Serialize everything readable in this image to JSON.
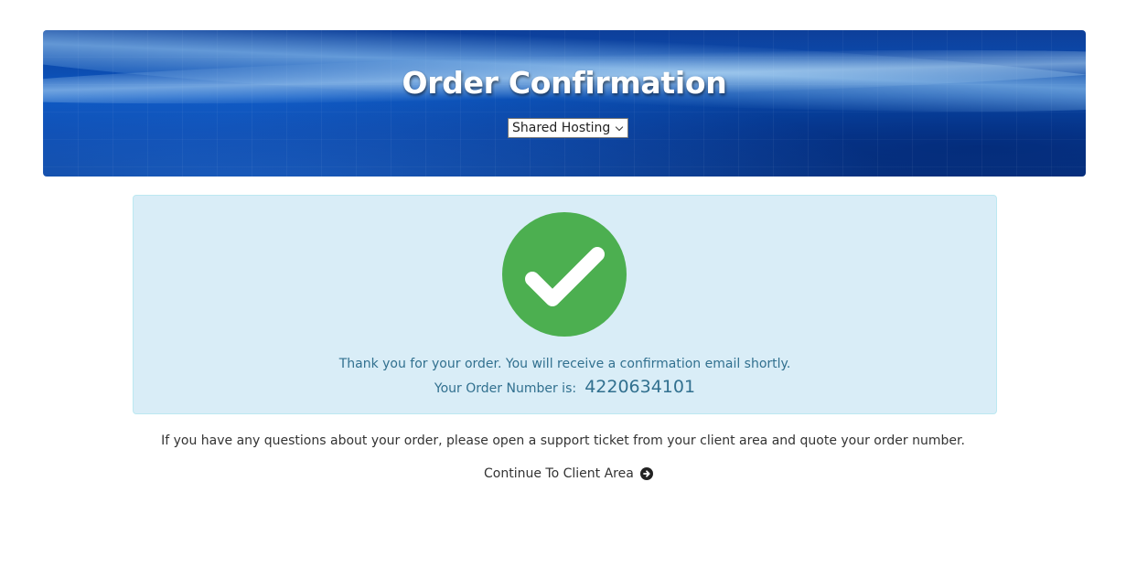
{
  "header": {
    "title": "Order Confirmation",
    "product_select": {
      "selected": "Shared Hosting",
      "icon": "chevron-down-icon"
    }
  },
  "confirmation": {
    "icon": "checkmark-circle-icon",
    "icon_color": "#4caf50",
    "background_color": "#d9edf7",
    "text_color": "#31708f",
    "thank_you_text": "Thank you for your order. You will receive a confirmation email shortly.",
    "order_number_label": "Your Order Number is:",
    "order_number": "4220634101"
  },
  "footer": {
    "questions_text": "If you have any questions about your order, please open a support ticket from your client area and quote your order number.",
    "continue_link": {
      "label": "Continue To Client Area",
      "icon": "arrow-circle-right-icon"
    }
  }
}
